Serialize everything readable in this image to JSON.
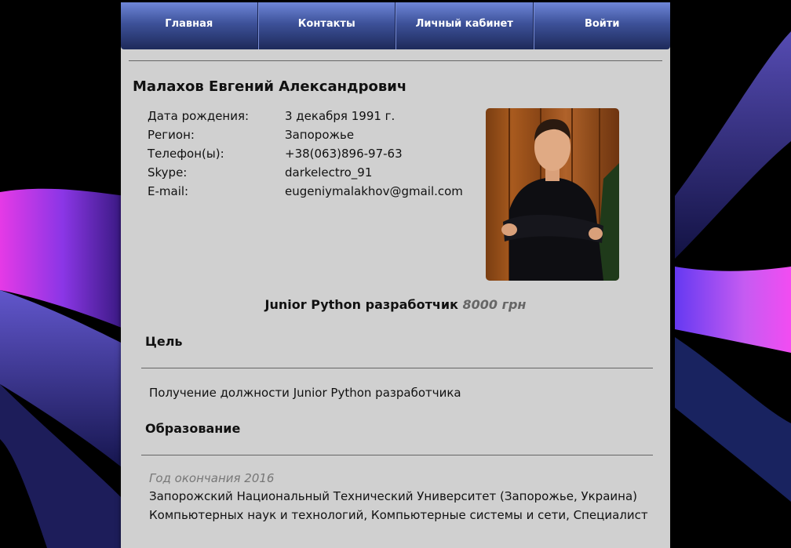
{
  "nav": {
    "items": [
      {
        "label": "Главная"
      },
      {
        "label": "Контакты"
      },
      {
        "label": "Личный кабинет"
      },
      {
        "label": "Войти"
      }
    ]
  },
  "profile": {
    "name": "Малахов Евгений Александрович",
    "fields": [
      {
        "label": "Дата рождения:",
        "value": "3 декабря 1991 г."
      },
      {
        "label": "Регион:",
        "value": "Запорожье"
      },
      {
        "label": "Телефон(ы):",
        "value": "+38(063)896-97-63"
      },
      {
        "label": "Skype:",
        "value": "darkelectro_91"
      },
      {
        "label": "E-mail:",
        "value": "eugeniymalakhov@gmail.com"
      }
    ]
  },
  "position": {
    "title": "Junior Python разработчик",
    "salary": "8000 грн"
  },
  "goal": {
    "heading": "Цель",
    "text": "Получение должности Junior Python разработчика"
  },
  "education": {
    "heading": "Образование",
    "year": "Год окончания 2016",
    "university": "Запорожский Национальный Технический Университет (Запорожье, Украина)",
    "details": "Компьютерных наук и технологий, Компьютерные системы и сети, Специалист"
  },
  "colors": {
    "nav_top": "#6e86d8",
    "nav_bottom": "#1e2a5a",
    "page_bg": "#d0d0d0",
    "salary": "#666666"
  }
}
